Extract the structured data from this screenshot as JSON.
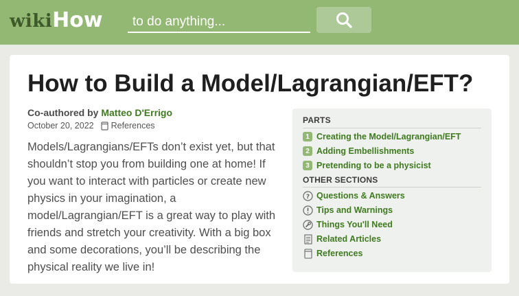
{
  "header": {
    "logo_wiki": "wiki",
    "logo_how": "How",
    "search_placeholder": "to do anything...",
    "search_icon": "search-icon"
  },
  "article": {
    "title": "How to Build a Model/Lagrangian/EFT?",
    "coauthored_label": "Co-authored by",
    "author": "Matteo D'Errigo",
    "date": "October 20, 2022",
    "references_label": "References",
    "intro": "Models/Lagrangians/EFTs don’t exist yet, but that shouldn’t stop you from building one at home! If you want to interact with particles or create new physics in your imagination, a model/Lagrangian/EFT is a great way to play with friends and stretch your creativity. With a big box and some decorations, you’ll be describing the physical reality we live in!"
  },
  "toc": {
    "parts_heading": "PARTS",
    "parts": [
      {
        "num": "1",
        "label": "Creating the Model/Lagrangian/EFT"
      },
      {
        "num": "2",
        "label": "Adding Embellishments"
      },
      {
        "num": "3",
        "label": "Pretending to be a physicist"
      }
    ],
    "other_heading": "OTHER SECTIONS",
    "other": [
      {
        "icon": "question-icon",
        "label": "Questions & Answers"
      },
      {
        "icon": "exclamation-icon",
        "label": "Tips and Warnings"
      },
      {
        "icon": "wrench-icon",
        "label": "Things You'll Need"
      },
      {
        "icon": "document-icon",
        "label": "Related Articles"
      },
      {
        "icon": "bookmark-icon",
        "label": "References"
      }
    ]
  },
  "colors": {
    "header_bg": "#93b874",
    "link_green": "#3f7a1f",
    "badge_green": "#93b874"
  }
}
